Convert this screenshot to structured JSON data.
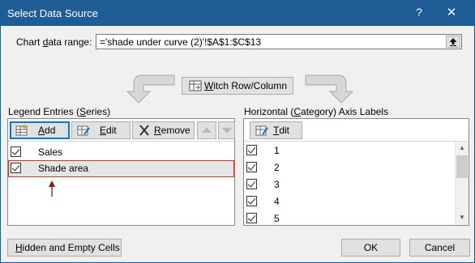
{
  "window": {
    "title": "Select Data Source",
    "help_label": "?",
    "close_label": "✕"
  },
  "range": {
    "label": "Chart data range:",
    "value": "='shade under curve (2)'!$A$1:$C$13"
  },
  "switch_button": {
    "label": "Switch Row/Column"
  },
  "legend": {
    "heading": "Legend Entries (Series)",
    "toolbar": {
      "add": "Add",
      "edit": "Edit",
      "remove": "Remove"
    },
    "items": [
      {
        "label": "Sales",
        "checked": true
      },
      {
        "label": "Shade area",
        "checked": true,
        "selected": true
      }
    ]
  },
  "axis": {
    "heading": "Horizontal (Category) Axis Labels",
    "toolbar": {
      "edit": "Edit"
    },
    "items": [
      {
        "label": "1",
        "checked": true
      },
      {
        "label": "2",
        "checked": true
      },
      {
        "label": "3",
        "checked": true
      },
      {
        "label": "4",
        "checked": true
      },
      {
        "label": "5",
        "checked": true
      }
    ]
  },
  "footer": {
    "hidden_empty": "Hidden and Empty Cells",
    "ok": "OK",
    "cancel": "Cancel"
  },
  "colors": {
    "titlebar": "#1f5d96",
    "selection_border": "#c0392b",
    "annotation_arrow": "#8b1a1a"
  }
}
